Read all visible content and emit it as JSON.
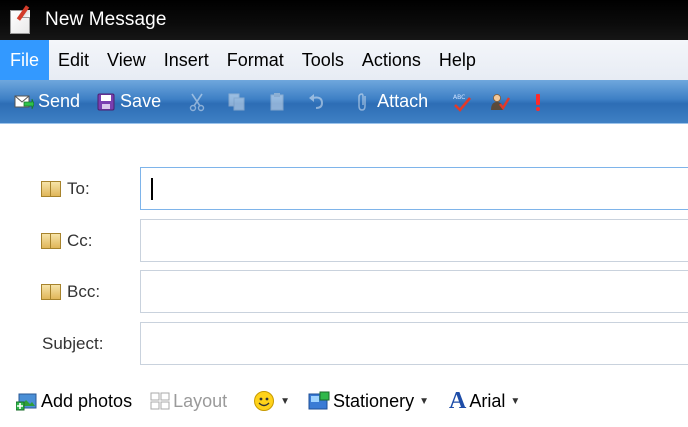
{
  "window": {
    "title": "New Message"
  },
  "menu": {
    "items": [
      {
        "label": "File",
        "active": true
      },
      {
        "label": "Edit"
      },
      {
        "label": "View"
      },
      {
        "label": "Insert"
      },
      {
        "label": "Format"
      },
      {
        "label": "Tools"
      },
      {
        "label": "Actions"
      },
      {
        "label": "Help"
      }
    ]
  },
  "toolbar": {
    "send_label": "Send",
    "save_label": "Save",
    "attach_label": "Attach",
    "icons": [
      "send-icon",
      "save-icon",
      "cut-icon",
      "copy-icon",
      "paste-icon",
      "undo-icon",
      "attach-icon",
      "spellcheck-icon",
      "contacts-check-icon",
      "priority-high-icon"
    ]
  },
  "fields": {
    "to": {
      "label": "To:",
      "value": ""
    },
    "cc": {
      "label": "Cc:",
      "value": ""
    },
    "bcc": {
      "label": "Bcc:",
      "value": ""
    },
    "subject": {
      "label": "Subject:",
      "value": ""
    }
  },
  "format_bar": {
    "add_photos_label": "Add photos",
    "layout_label": "Layout",
    "stationery_label": "Stationery",
    "font_name": "Arial",
    "font_icon_letter": "A"
  },
  "colors": {
    "title_bar": "#000000",
    "menu_active": "#3399ff",
    "toolbar": "#3d7fc5",
    "focused_border": "#7eb4ea"
  }
}
